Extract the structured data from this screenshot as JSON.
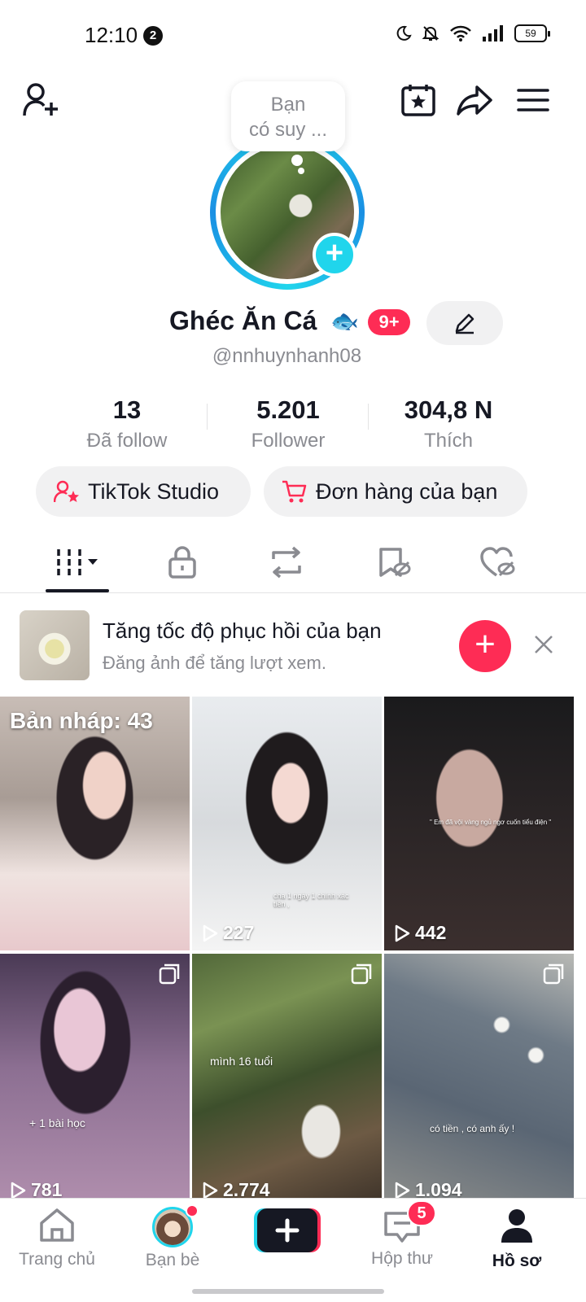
{
  "status_bar": {
    "time": "12:10",
    "notification_count": "2",
    "battery": "59"
  },
  "note": {
    "line1": "Bạn",
    "line2": "có suy ..."
  },
  "profile": {
    "display_name": "Ghéc Ăn Cá",
    "name_emoji": "🐟",
    "badge": "9+",
    "username": "@nnhuynhanh08"
  },
  "stats": [
    {
      "value": "13",
      "label": "Đã follow"
    },
    {
      "value": "5.201",
      "label": "Follower"
    },
    {
      "value": "304,8 N",
      "label": "Thích"
    }
  ],
  "buttons": {
    "studio": "TikTok Studio",
    "orders": "Đơn hàng của bạn"
  },
  "promo": {
    "title": "Tăng tốc độ phục hồi của bạn",
    "subtitle": "Đăng ảnh để tăng lượt xem."
  },
  "videos": [
    {
      "draft_label": "Bản nháp: 43"
    },
    {
      "views": "227"
    },
    {
      "views": "442"
    },
    {
      "views": "781",
      "caption": "+ 1 bài học"
    },
    {
      "views": "2.774",
      "caption": "mình 16 tuổi"
    },
    {
      "views": "1.094",
      "caption": "có tiền , có anh ấy !"
    }
  ],
  "captions_small": {
    "v2": "cha 1 ngày 1 chính xác tiền ,",
    "v3": "\" Em đã vội vàng ngủ ngơ cuốn tiểu điện \""
  },
  "nav": {
    "home": "Trang chủ",
    "friends": "Bạn bè",
    "inbox": "Hộp thư",
    "inbox_count": "5",
    "profile": "Hồ sơ"
  },
  "colors": {
    "accent": "#fe2c55",
    "cyan": "#20d5ec",
    "text": "#161823",
    "muted": "#8a8b91"
  }
}
